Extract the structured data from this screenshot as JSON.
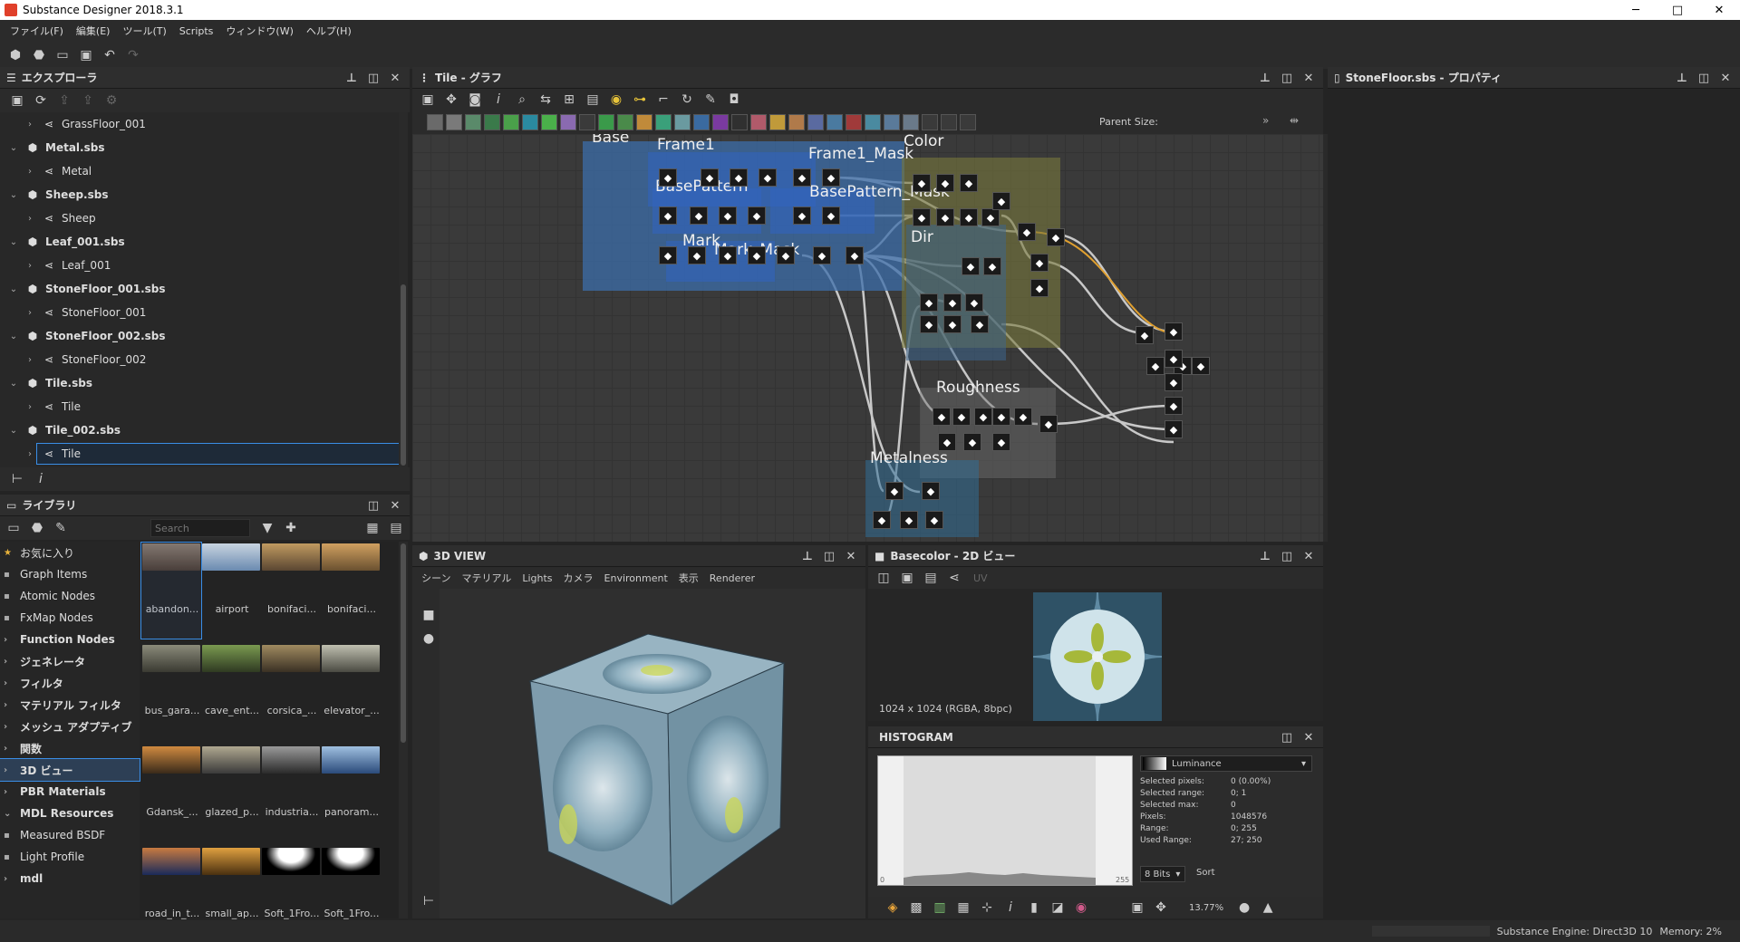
{
  "window": {
    "title": "Substance Designer 2018.3.1",
    "minimize": "─",
    "maximize": "□",
    "close": "✕"
  },
  "menu": [
    "ファイル(F)",
    "編集(E)",
    "ツール(T)",
    "Scripts",
    "ウィンドウ(W)",
    "ヘルプ(H)"
  ],
  "explorer": {
    "title": "エクスプローラ",
    "items": [
      {
        "label": "GrassFloor_001",
        "level": 2
      },
      {
        "label": "Metal.sbs",
        "level": 1
      },
      {
        "label": "Metal",
        "level": 2
      },
      {
        "label": "Sheep.sbs",
        "level": 1
      },
      {
        "label": "Sheep",
        "level": 2
      },
      {
        "label": "Leaf_001.sbs",
        "level": 1
      },
      {
        "label": "Leaf_001",
        "level": 2
      },
      {
        "label": "StoneFloor_001.sbs",
        "level": 1
      },
      {
        "label": "StoneFloor_001",
        "level": 2
      },
      {
        "label": "StoneFloor_002.sbs",
        "level": 1
      },
      {
        "label": "StoneFloor_002",
        "level": 2
      },
      {
        "label": "Tile.sbs",
        "level": 1
      },
      {
        "label": "Tile",
        "level": 2
      },
      {
        "label": "Tile_002.sbs",
        "level": 1
      },
      {
        "label": "Tile",
        "level": 2,
        "selected": true
      }
    ]
  },
  "library": {
    "title": "ライブラリ",
    "search_placeholder": "Search",
    "categories": [
      {
        "label": "お気に入り",
        "icon": "star-icon",
        "bold": false
      },
      {
        "label": "Graph Items",
        "icon": "square-icon",
        "bold": false
      },
      {
        "label": "Atomic Nodes",
        "icon": "square-icon",
        "bold": false
      },
      {
        "label": "FxMap Nodes",
        "icon": "square-icon",
        "bold": false
      },
      {
        "label": "Function Nodes",
        "icon": "chevron-right-icon",
        "bold": true
      },
      {
        "label": "ジェネレータ",
        "icon": "chevron-right-icon",
        "bold": true
      },
      {
        "label": "フィルタ",
        "icon": "chevron-right-icon",
        "bold": true
      },
      {
        "label": "マテリアル フィルタ",
        "icon": "chevron-right-icon",
        "bold": true
      },
      {
        "label": "メッシュ アダプティブ",
        "icon": "chevron-right-icon",
        "bold": true
      },
      {
        "label": "関数",
        "icon": "chevron-right-icon",
        "bold": true
      },
      {
        "label": "3D ビュー",
        "icon": "chevron-right-icon",
        "bold": true,
        "selected": true
      },
      {
        "label": "PBR Materials",
        "icon": "chevron-right-icon",
        "bold": true
      },
      {
        "label": "MDL Resources",
        "icon": "chevron-down-icon",
        "bold": true
      },
      {
        "label": "Measured BSDF",
        "icon": "square-icon",
        "bold": false
      },
      {
        "label": "Light Profile",
        "icon": "square-icon",
        "bold": false
      },
      {
        "label": "mdl",
        "icon": "chevron-right-icon",
        "bold": true
      }
    ],
    "thumbnails": [
      "abandon...",
      "airport",
      "bonifaci...",
      "bonifaci...",
      "bus_gara...",
      "cave_ent...",
      "corsica_...",
      "elevator_...",
      "Gdansk_...",
      "glazed_p...",
      "industria...",
      "panoram...",
      "road_in_t...",
      "small_ap...",
      "Soft_1Fro...",
      "Soft_1Fro..."
    ]
  },
  "graph": {
    "title": "Tile - グラフ",
    "parent_size_label": "Parent Size:",
    "frames": [
      "Base",
      "Frame1",
      "Frame1_Mask",
      "Color",
      "BasePattern",
      "BasePattern_Mask",
      "Dir",
      "Mark",
      "Mark_Mask",
      "Roughness",
      "Metalness"
    ]
  },
  "view3d": {
    "title": "3D VIEW",
    "menu": [
      "シーン",
      "マテリアル",
      "Lights",
      "カメラ",
      "Environment",
      "表示",
      "Renderer"
    ]
  },
  "view2d": {
    "title": "Basecolor - 2D ビュー",
    "uv_label": "UV",
    "resolution": "1024 x 1024 (RGBA, 8bpc)"
  },
  "histogram": {
    "title": "HISTOGRAM",
    "channel": "Luminance",
    "stats": [
      {
        "k": "Selected pixels:",
        "v": "0 (0.00%)"
      },
      {
        "k": "Selected range:",
        "v": "0; 1"
      },
      {
        "k": "Selected max:",
        "v": "0"
      },
      {
        "k": "Pixels:",
        "v": "1048576"
      },
      {
        "k": "Range:",
        "v": "0; 255"
      },
      {
        "k": "Used Range:",
        "v": "27; 250"
      }
    ],
    "bits": "8 Bits",
    "sort": "Sort",
    "zoom": "13.77%",
    "axis_min": "0",
    "axis_max": "255"
  },
  "properties": {
    "title": "StoneFloor.sbs - プロパティ"
  },
  "status": {
    "engine": "Substance Engine: Direct3D 10",
    "memory": "Memory: 2%"
  }
}
